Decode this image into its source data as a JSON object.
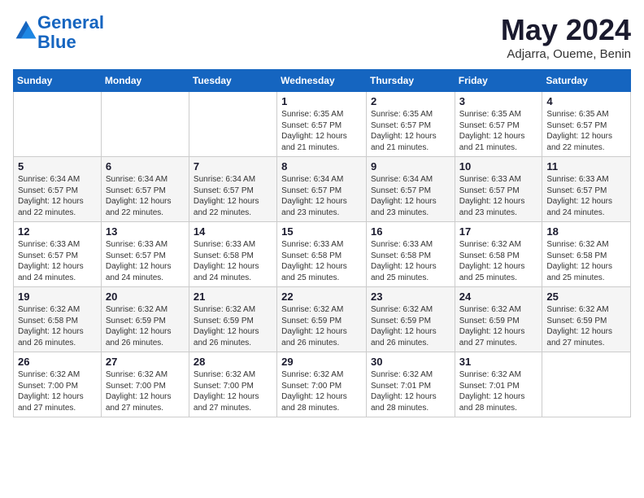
{
  "logo": {
    "line1": "General",
    "line2": "Blue"
  },
  "title": "May 2024",
  "location": "Adjarra, Oueme, Benin",
  "days_header": [
    "Sunday",
    "Monday",
    "Tuesday",
    "Wednesday",
    "Thursday",
    "Friday",
    "Saturday"
  ],
  "weeks": [
    [
      {
        "num": "",
        "info": ""
      },
      {
        "num": "",
        "info": ""
      },
      {
        "num": "",
        "info": ""
      },
      {
        "num": "1",
        "info": "Sunrise: 6:35 AM\nSunset: 6:57 PM\nDaylight: 12 hours\nand 21 minutes."
      },
      {
        "num": "2",
        "info": "Sunrise: 6:35 AM\nSunset: 6:57 PM\nDaylight: 12 hours\nand 21 minutes."
      },
      {
        "num": "3",
        "info": "Sunrise: 6:35 AM\nSunset: 6:57 PM\nDaylight: 12 hours\nand 21 minutes."
      },
      {
        "num": "4",
        "info": "Sunrise: 6:35 AM\nSunset: 6:57 PM\nDaylight: 12 hours\nand 22 minutes."
      }
    ],
    [
      {
        "num": "5",
        "info": "Sunrise: 6:34 AM\nSunset: 6:57 PM\nDaylight: 12 hours\nand 22 minutes."
      },
      {
        "num": "6",
        "info": "Sunrise: 6:34 AM\nSunset: 6:57 PM\nDaylight: 12 hours\nand 22 minutes."
      },
      {
        "num": "7",
        "info": "Sunrise: 6:34 AM\nSunset: 6:57 PM\nDaylight: 12 hours\nand 22 minutes."
      },
      {
        "num": "8",
        "info": "Sunrise: 6:34 AM\nSunset: 6:57 PM\nDaylight: 12 hours\nand 23 minutes."
      },
      {
        "num": "9",
        "info": "Sunrise: 6:34 AM\nSunset: 6:57 PM\nDaylight: 12 hours\nand 23 minutes."
      },
      {
        "num": "10",
        "info": "Sunrise: 6:33 AM\nSunset: 6:57 PM\nDaylight: 12 hours\nand 23 minutes."
      },
      {
        "num": "11",
        "info": "Sunrise: 6:33 AM\nSunset: 6:57 PM\nDaylight: 12 hours\nand 24 minutes."
      }
    ],
    [
      {
        "num": "12",
        "info": "Sunrise: 6:33 AM\nSunset: 6:57 PM\nDaylight: 12 hours\nand 24 minutes."
      },
      {
        "num": "13",
        "info": "Sunrise: 6:33 AM\nSunset: 6:57 PM\nDaylight: 12 hours\nand 24 minutes."
      },
      {
        "num": "14",
        "info": "Sunrise: 6:33 AM\nSunset: 6:58 PM\nDaylight: 12 hours\nand 24 minutes."
      },
      {
        "num": "15",
        "info": "Sunrise: 6:33 AM\nSunset: 6:58 PM\nDaylight: 12 hours\nand 25 minutes."
      },
      {
        "num": "16",
        "info": "Sunrise: 6:33 AM\nSunset: 6:58 PM\nDaylight: 12 hours\nand 25 minutes."
      },
      {
        "num": "17",
        "info": "Sunrise: 6:32 AM\nSunset: 6:58 PM\nDaylight: 12 hours\nand 25 minutes."
      },
      {
        "num": "18",
        "info": "Sunrise: 6:32 AM\nSunset: 6:58 PM\nDaylight: 12 hours\nand 25 minutes."
      }
    ],
    [
      {
        "num": "19",
        "info": "Sunrise: 6:32 AM\nSunset: 6:58 PM\nDaylight: 12 hours\nand 26 minutes."
      },
      {
        "num": "20",
        "info": "Sunrise: 6:32 AM\nSunset: 6:59 PM\nDaylight: 12 hours\nand 26 minutes."
      },
      {
        "num": "21",
        "info": "Sunrise: 6:32 AM\nSunset: 6:59 PM\nDaylight: 12 hours\nand 26 minutes."
      },
      {
        "num": "22",
        "info": "Sunrise: 6:32 AM\nSunset: 6:59 PM\nDaylight: 12 hours\nand 26 minutes."
      },
      {
        "num": "23",
        "info": "Sunrise: 6:32 AM\nSunset: 6:59 PM\nDaylight: 12 hours\nand 26 minutes."
      },
      {
        "num": "24",
        "info": "Sunrise: 6:32 AM\nSunset: 6:59 PM\nDaylight: 12 hours\nand 27 minutes."
      },
      {
        "num": "25",
        "info": "Sunrise: 6:32 AM\nSunset: 6:59 PM\nDaylight: 12 hours\nand 27 minutes."
      }
    ],
    [
      {
        "num": "26",
        "info": "Sunrise: 6:32 AM\nSunset: 7:00 PM\nDaylight: 12 hours\nand 27 minutes."
      },
      {
        "num": "27",
        "info": "Sunrise: 6:32 AM\nSunset: 7:00 PM\nDaylight: 12 hours\nand 27 minutes."
      },
      {
        "num": "28",
        "info": "Sunrise: 6:32 AM\nSunset: 7:00 PM\nDaylight: 12 hours\nand 27 minutes."
      },
      {
        "num": "29",
        "info": "Sunrise: 6:32 AM\nSunset: 7:00 PM\nDaylight: 12 hours\nand 28 minutes."
      },
      {
        "num": "30",
        "info": "Sunrise: 6:32 AM\nSunset: 7:01 PM\nDaylight: 12 hours\nand 28 minutes."
      },
      {
        "num": "31",
        "info": "Sunrise: 6:32 AM\nSunset: 7:01 PM\nDaylight: 12 hours\nand 28 minutes."
      },
      {
        "num": "",
        "info": ""
      }
    ]
  ]
}
